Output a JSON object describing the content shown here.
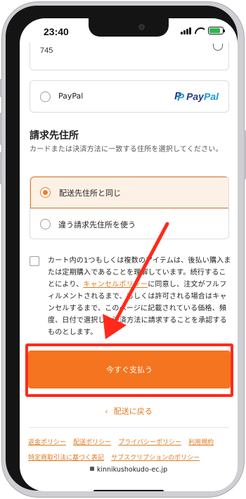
{
  "status_bar": {
    "time": "23:40"
  },
  "address_partial": {
    "value": "745"
  },
  "payment": {
    "paypal_label": "PayPal",
    "paypal_logo_text": "PayPal"
  },
  "billing": {
    "title": "請求先住所",
    "description": "カードまたは決済方法に一致する住所を選択してください。",
    "options": [
      {
        "label": "配送先住所と同じ",
        "selected": true
      },
      {
        "label": "違う請求先住所を使う",
        "selected": false
      }
    ]
  },
  "consent": {
    "text_before": "カート内の1つもしくは複数のアイテムは、後払い購入または定期購入であることを理解しています。続行することにより、",
    "link": "キャンセルポリシー",
    "text_after": "に同意し、注文がフルフィルメントされるまで、もしくは許可される場合はキャンセルするまで、このページに記載されている価格、頻度、日付で選択した決済方法に請求することを承認するものとします。"
  },
  "pay_button": {
    "label": "今すぐ支払う"
  },
  "back_link": {
    "icon": "chevron-left-icon",
    "label": "配送に戻る"
  },
  "footer_links": [
    "返金ポリシー",
    "配送ポリシー",
    "プライバシーポリシー",
    "利用規約",
    "特定商取引法に基づく表記",
    "サブスクリプションのポリシー"
  ],
  "url_bar": {
    "domain": "kinnikushokudo-ec.jp"
  },
  "colors": {
    "accent": "#f5741f",
    "annotation_red": "#ff2a1a",
    "paypal_dark": "#253b80",
    "paypal_light": "#179bd7"
  }
}
